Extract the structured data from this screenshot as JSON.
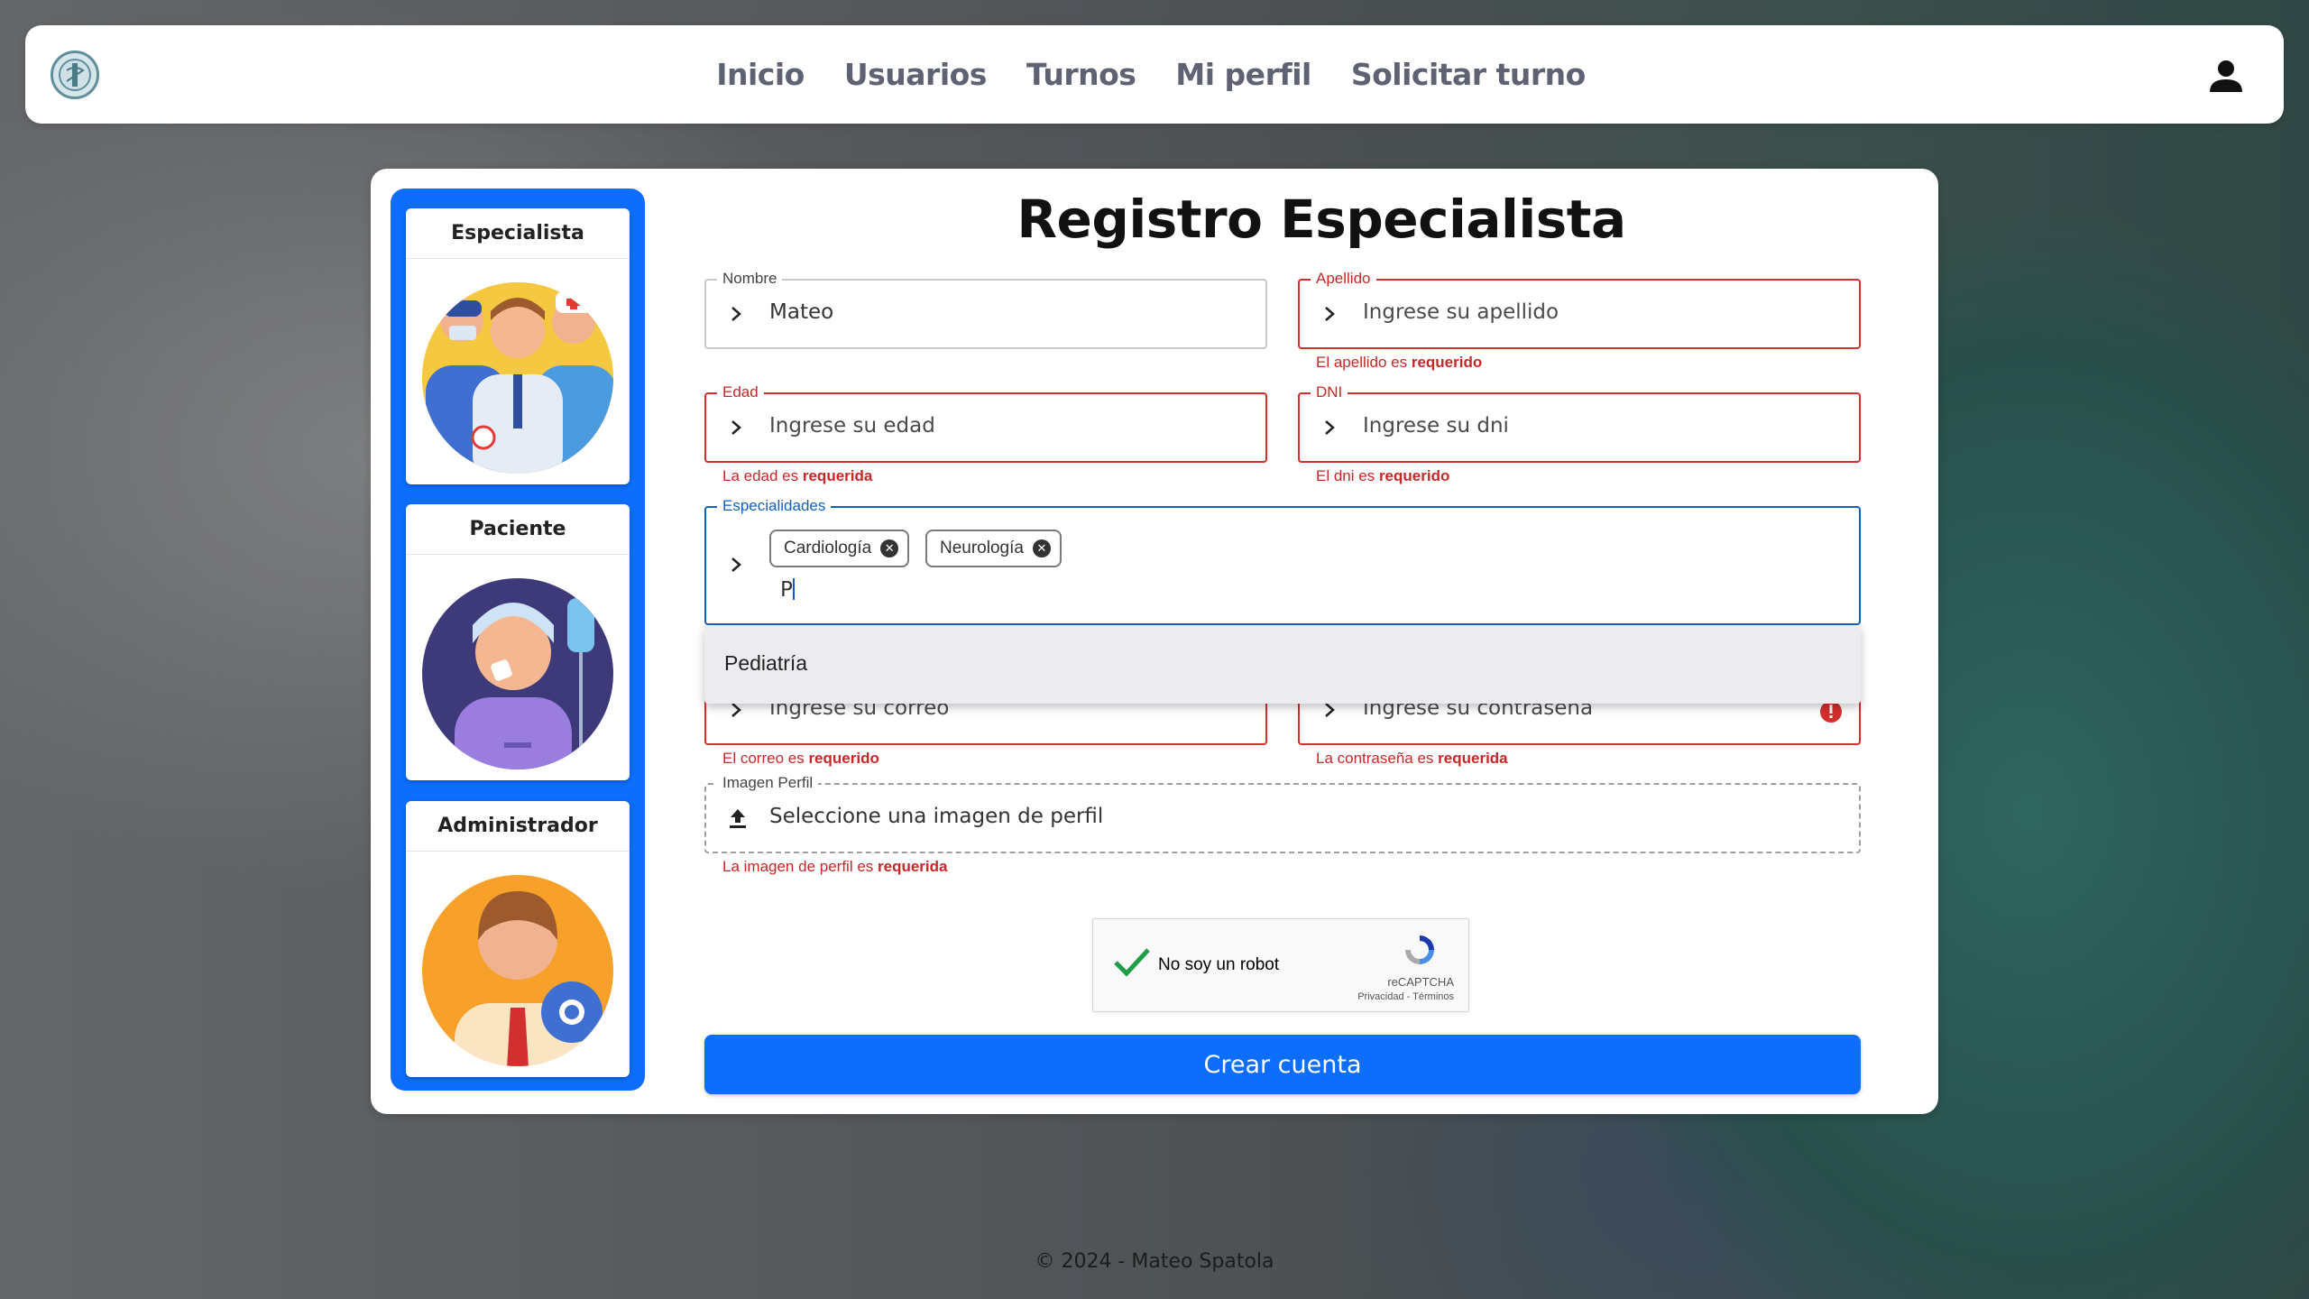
{
  "nav": {
    "links": [
      "Inicio",
      "Usuarios",
      "Turnos",
      "Mi perfil",
      "Solicitar turno"
    ],
    "logo_icon": "medical-logo-icon",
    "user_icon": "user-icon"
  },
  "roles": [
    {
      "label": "Especialista",
      "icon": "doctors-group-illustration"
    },
    {
      "label": "Paciente",
      "icon": "patient-illustration"
    },
    {
      "label": "Administrador",
      "icon": "admin-illustration"
    }
  ],
  "form": {
    "title": "Registro Especialista",
    "nombre": {
      "label": "Nombre",
      "value": "Mateo"
    },
    "apellido": {
      "label": "Apellido",
      "placeholder": "Ingrese su apellido",
      "error_prefix": "El apellido es ",
      "error_strong": "requerido"
    },
    "edad": {
      "label": "Edad",
      "placeholder": "Ingrese su edad",
      "error_prefix": "La edad es ",
      "error_strong": "requerida"
    },
    "dni": {
      "label": "DNI",
      "placeholder": "Ingrese su dni",
      "error_prefix": "El dni es ",
      "error_strong": "requerido"
    },
    "especialidades": {
      "label": "Especialidades",
      "chips": [
        "Cardiología",
        "Neurología"
      ],
      "input_value": "P",
      "suggestion": "Pediatría"
    },
    "correo": {
      "placeholder": "Ingrese su correo",
      "error_prefix": "El correo es ",
      "error_strong": "requerido"
    },
    "contrasena": {
      "placeholder": "Ingrese su contraseña",
      "error_prefix": "La contraseña es ",
      "error_strong": "requerida"
    },
    "imagen": {
      "label": "Imagen Perfil",
      "placeholder": "Seleccione una imagen de perfil",
      "error_prefix": "La imagen de perfil es ",
      "error_strong": "requerida"
    },
    "captcha": {
      "label": "No soy un robot",
      "brand": "reCAPTCHA",
      "links": "Privacidad - Términos"
    },
    "submit": "Crear cuenta"
  },
  "footer": "© 2024 - Mateo Spatola",
  "colors": {
    "primary": "#0d6efd",
    "error": "#c62828",
    "focus": "#1560bd"
  }
}
